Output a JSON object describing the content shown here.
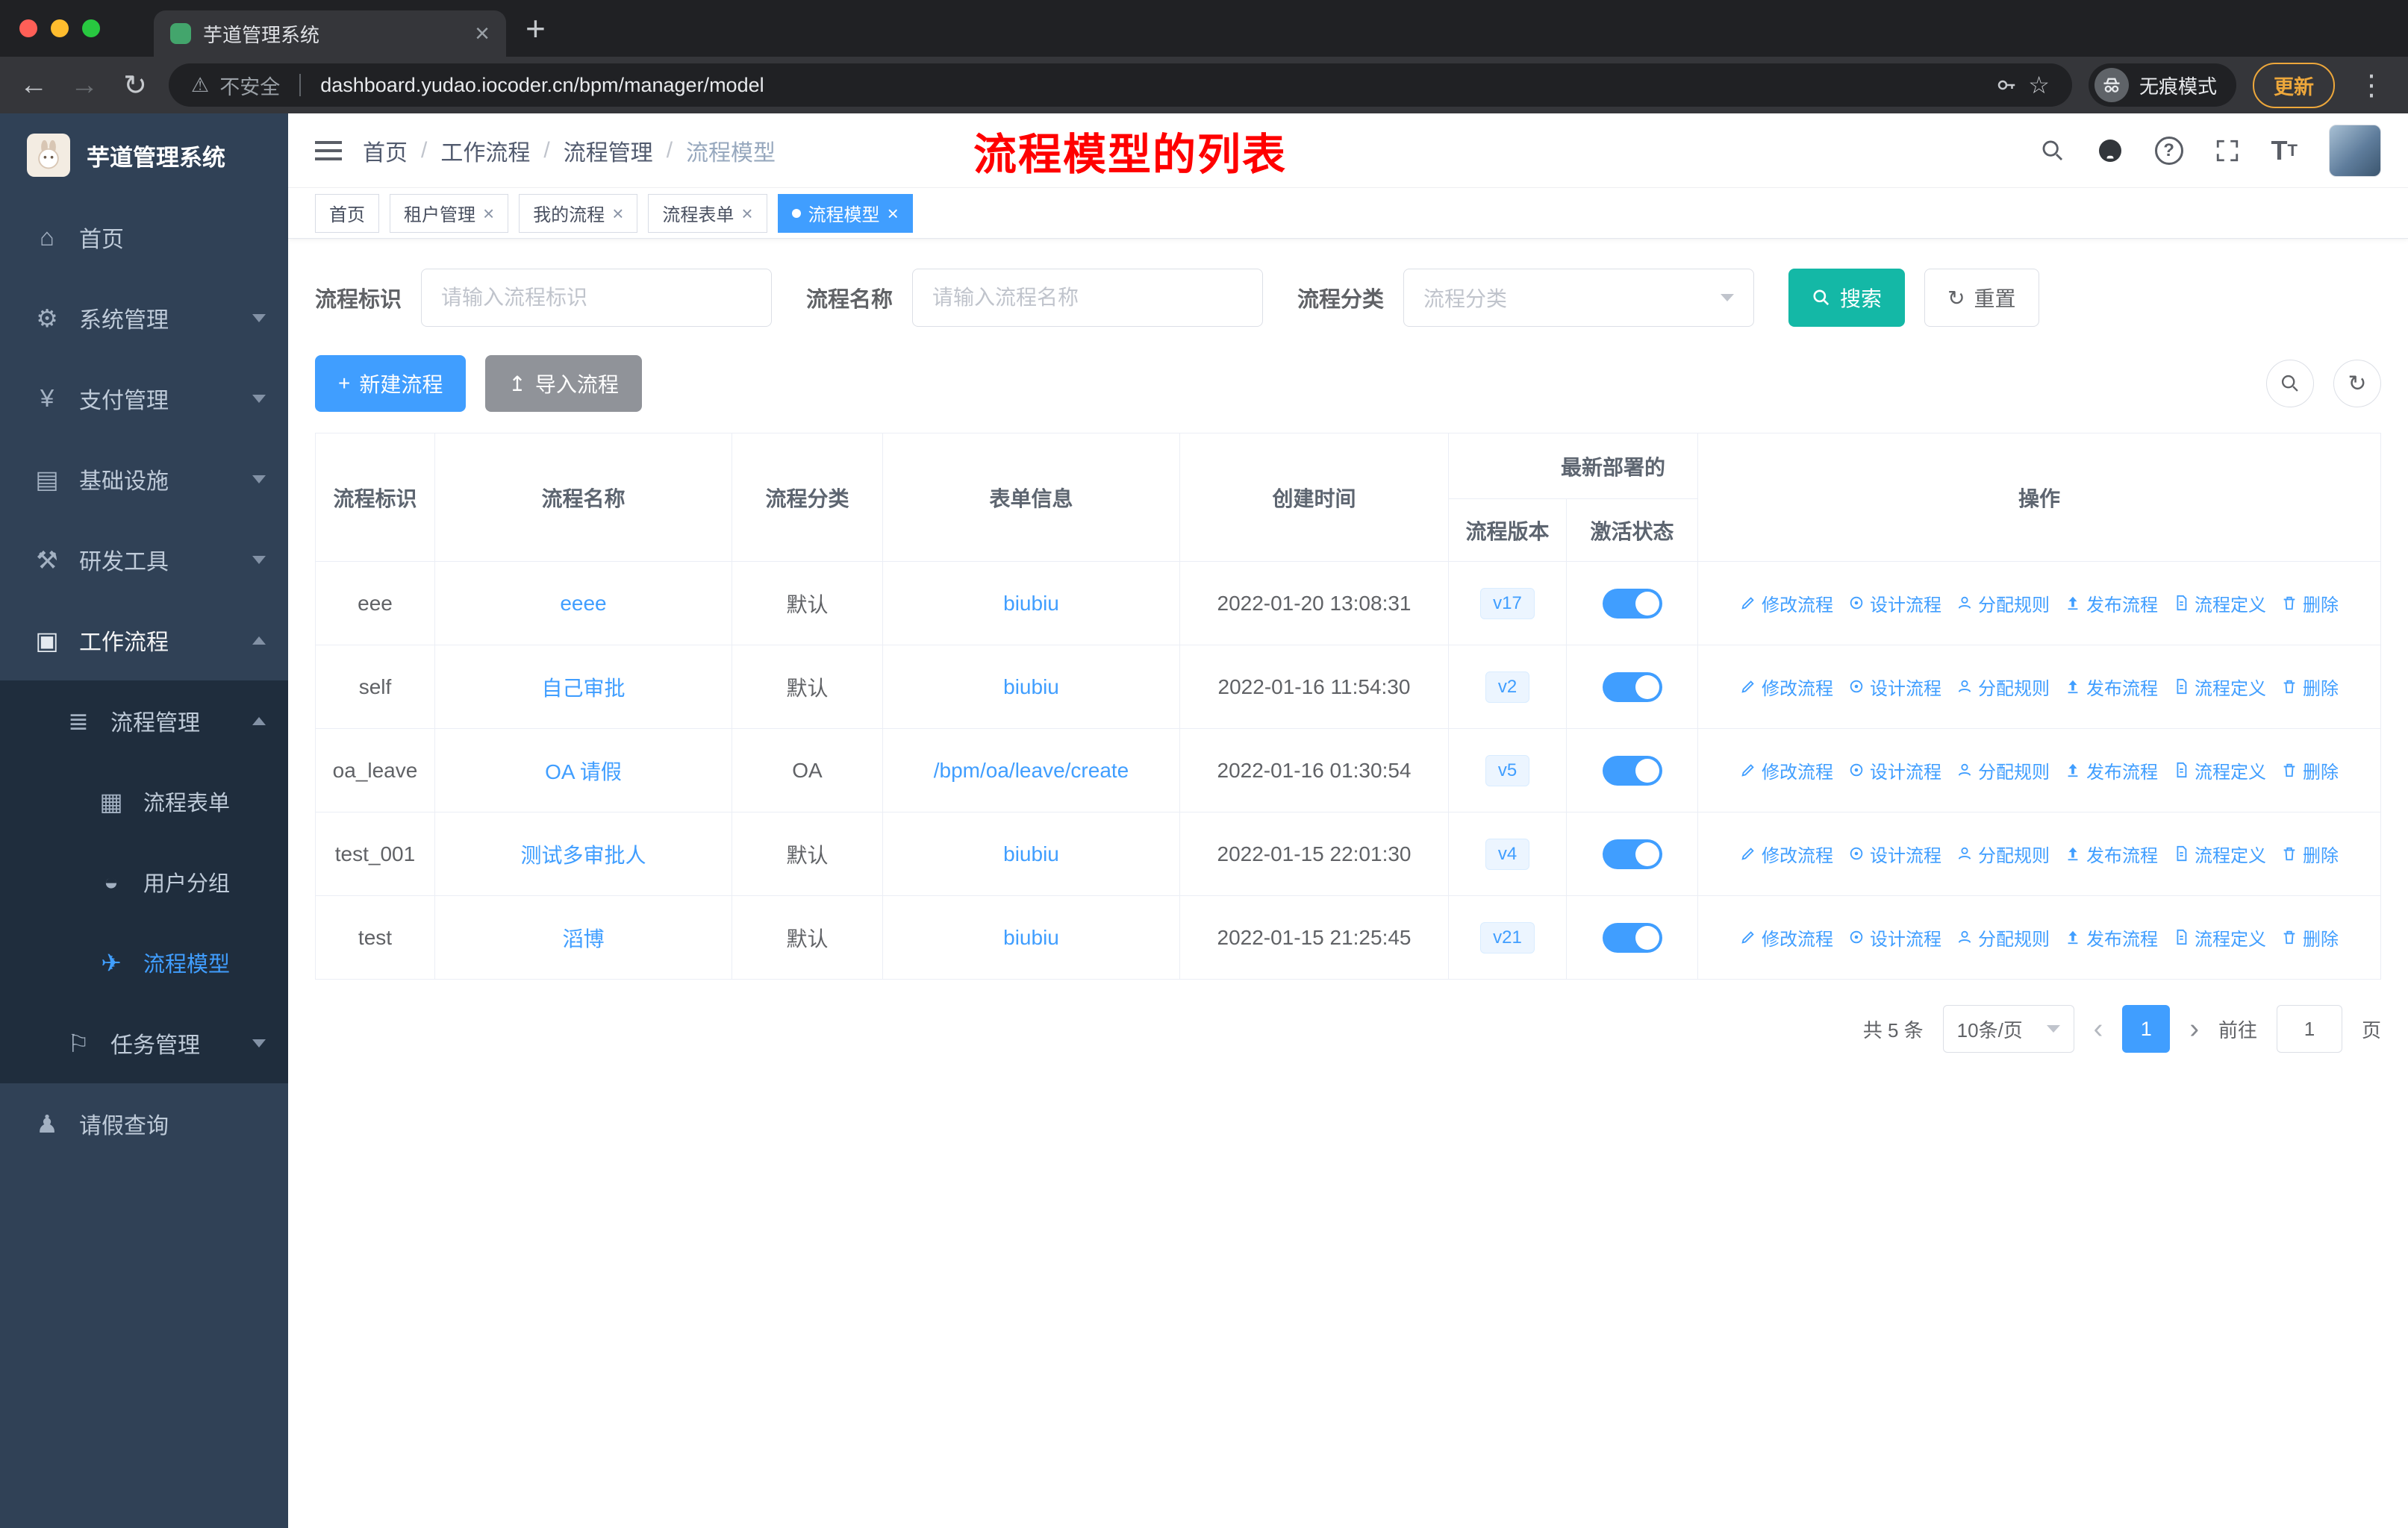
{
  "colors": {
    "primary": "#409eff",
    "search_button": "#14b8a6",
    "annotation_red": "#ff0000",
    "sidebar_bg": "#304156",
    "submenu_bg": "#1f2d3d",
    "toggle_on": "#409eff"
  },
  "annotation": "流程模型的列表",
  "browser": {
    "tab_title": "芋道管理系统",
    "security_text": "不安全",
    "url": "dashboard.yudao.iocoder.cn/bpm/manager/model",
    "incognito_label": "无痕模式",
    "update_label": "更新"
  },
  "icons": {
    "back": "←",
    "forward": "→",
    "reload": "↻",
    "warning": "⚠",
    "star": "☆",
    "menu_dots": "⋮",
    "close": "×",
    "plus": "+",
    "help": "?",
    "font_size": "T",
    "font_size_small": "T",
    "reset": "↻",
    "import": "↥",
    "create_plus": "+",
    "refresh": "↻",
    "prev": "‹",
    "next": "›"
  },
  "sidebar": {
    "title": "芋道管理系统",
    "menu": [
      {
        "label": "首页",
        "icon": "⌂"
      },
      {
        "label": "系统管理",
        "icon": "⚙"
      },
      {
        "label": "支付管理",
        "icon": "¥"
      },
      {
        "label": "基础设施",
        "icon": "▤"
      },
      {
        "label": "研发工具",
        "icon": "⚒"
      },
      {
        "label": "工作流程",
        "icon": "▣"
      },
      {
        "label": "流程管理",
        "icon": "≣"
      },
      {
        "label": "流程表单",
        "icon": "▦"
      },
      {
        "label": "用户分组",
        "icon": "◒"
      },
      {
        "label": "流程模型",
        "icon": "✈"
      },
      {
        "label": "任务管理",
        "icon": "⚐"
      },
      {
        "label": "请假查询",
        "icon": "♟"
      }
    ]
  },
  "navbar": {
    "breadcrumb": [
      "首页",
      "工作流程",
      "流程管理",
      "流程模型"
    ]
  },
  "tags": [
    {
      "label": "首页"
    },
    {
      "label": "租户管理"
    },
    {
      "label": "我的流程"
    },
    {
      "label": "流程表单"
    },
    {
      "label": "流程模型"
    }
  ],
  "filter": {
    "fields": [
      {
        "label": "流程标识",
        "placeholder": "请输入流程标识"
      },
      {
        "label": "流程名称",
        "placeholder": "请输入流程名称"
      },
      {
        "label": "流程分类",
        "placeholder": "流程分类"
      }
    ],
    "search_label": "搜索",
    "reset_label": "重置"
  },
  "toolbar": {
    "create_label": "新建流程",
    "import_label": "导入流程"
  },
  "table": {
    "columns": [
      "流程标识",
      "流程名称",
      "流程分类",
      "表单信息",
      "创建时间",
      "流程版本",
      "激活状态",
      "操作"
    ],
    "group_header": "最新部署的",
    "action_labels": [
      "修改流程",
      "设计流程",
      "分配规则",
      "发布流程",
      "流程定义",
      "删除"
    ],
    "rows": [
      {
        "id": "eee",
        "name": "eeee",
        "category": "默认",
        "form": "biubiu",
        "created": "2022-01-20 13:08:31",
        "version": "v17",
        "active": true
      },
      {
        "id": "self",
        "name": "自己审批",
        "category": "默认",
        "form": "biubiu",
        "created": "2022-01-16 11:54:30",
        "version": "v2",
        "active": true
      },
      {
        "id": "oa_leave",
        "name": "OA 请假",
        "category": "OA",
        "form": "/bpm/oa/leave/create",
        "created": "2022-01-16 01:30:54",
        "version": "v5",
        "active": true
      },
      {
        "id": "test_001",
        "name": "测试多审批人",
        "category": "默认",
        "form": "biubiu",
        "created": "2022-01-15 22:01:30",
        "version": "v4",
        "active": true
      },
      {
        "id": "test",
        "name": "滔博",
        "category": "默认",
        "form": "biubiu",
        "created": "2022-01-15 21:25:45",
        "version": "v21",
        "active": true
      }
    ]
  },
  "pagination": {
    "total_text": "共 5 条",
    "page_size": "10条/页",
    "current_page": "1",
    "goto_label": "前往",
    "goto_value": "1",
    "page_label": "页"
  }
}
